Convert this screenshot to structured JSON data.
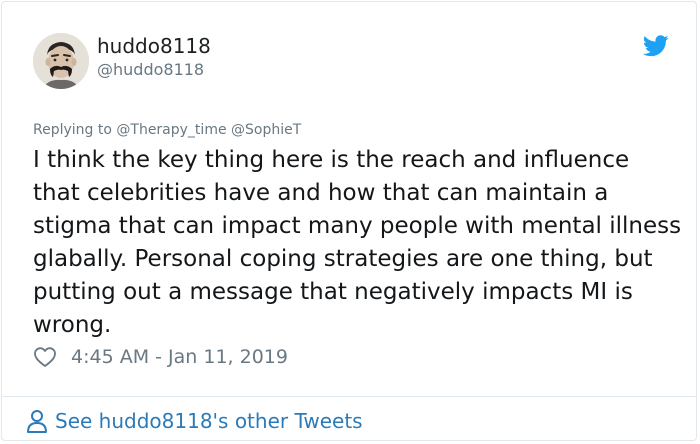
{
  "author": {
    "display_name": "huddo8118",
    "handle": "@huddo8118",
    "avatar": "avatar-image"
  },
  "reply": {
    "prefix": "Replying to",
    "mentions": [
      "@Therapy_time",
      "@SophieT"
    ]
  },
  "tweet": {
    "text": "I think the key thing here is the reach and influence that celebrities have and how that can maintain a stigma that can impact many people with mental illness glabally. Personal coping strategies are one thing, but putting out a message that negatively impacts MI is wrong.",
    "timestamp": "4:45 AM - Jan 11, 2019"
  },
  "footer": {
    "link_text": "See huddo8118's other Tweets"
  },
  "icons": {
    "brand": "twitter-bird-icon",
    "like": "heart-icon",
    "profile": "person-icon"
  },
  "colors": {
    "brand_blue": "#1da1f2",
    "link_blue": "#2b7bb9",
    "muted": "#697882",
    "text": "#14171a",
    "border": "#e1e8ed"
  }
}
